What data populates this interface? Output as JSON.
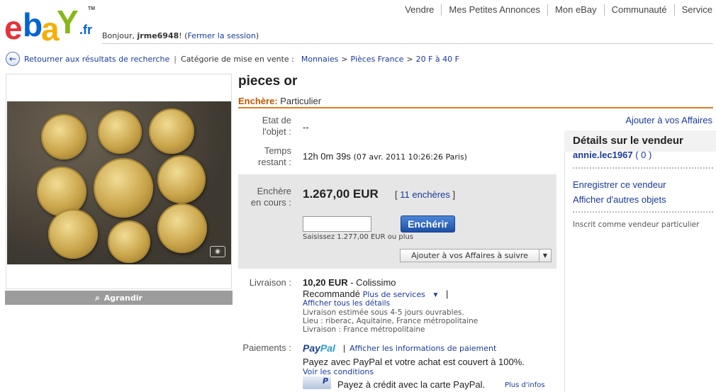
{
  "logo": {
    "e": "e",
    "b": "b",
    "a": "a",
    "y": "Y",
    "tld": ".fr",
    "tm": "TM"
  },
  "header": {
    "greeting_prefix": "Bonjour, ",
    "username": "jrme6948",
    "greeting_suffix": "! (",
    "logout": "Fermer la session",
    "close_paren": ")",
    "nav": [
      "Vendre",
      "Mes Petites Annonces",
      "Mon eBay",
      "Communauté",
      "Service"
    ]
  },
  "breadcrumb": {
    "back": "Retourner aux résultats de recherche",
    "sep": "|",
    "category_label": "Catégorie de mise en vente :",
    "items": [
      "Monnaies",
      "Pièces France",
      "20 F à 40 F"
    ],
    "arrow": ">"
  },
  "image": {
    "enlarge": "Agrandir"
  },
  "item": {
    "title": "pieces or",
    "type_label": "Enchère:",
    "type_value": "Particulier",
    "condition_label_1": "Etat de",
    "condition_label_2": "l'objet :",
    "condition_value": "--",
    "time_label_1": "Temps",
    "time_label_2": "restant :",
    "time_value": "12h 0m 39s",
    "time_date": "(07 avr. 2011 10:26:26 Paris)"
  },
  "bid": {
    "label_1": "Enchère",
    "label_2": "en cours :",
    "price": "1.267,00 EUR",
    "bids_open": "[",
    "bids_link": "11 enchères",
    "bids_close": "]",
    "input_value": "",
    "button": "Enchérir",
    "hint": "Saisissez 1.277,00 EUR ou plus",
    "watch_button": "Ajouter à vos Affaires à suivre"
  },
  "shipping": {
    "label": "Livraison :",
    "price": "10,20 EUR",
    "method_1": " - Colissimo",
    "method_2": "Recommandé",
    "more_services": "Plus de services",
    "pipe": "|",
    "all_details": "Afficher tous les détails",
    "estimate": "Livraison estimée sous 4-5 jours ouvrables.",
    "location": "Lieu : riberac, Aquitaine, France métropolitaine",
    "delivery": "Livraison : France métropolitaine"
  },
  "payment": {
    "label": "Paiements :",
    "logo_1": "Pay",
    "logo_2": "Pal",
    "pipe": "|",
    "info_link": "Afficher les informations de paiement",
    "coverage": "Payez avec PayPal et votre achat est couvert à 100%.",
    "conditions": "Voir les conditions",
    "credit": "Payez à crédit avec la carte PayPal.",
    "more_info": "Plus d'infos"
  },
  "seller": {
    "add_link": "Ajouter à vos Affaires",
    "heading": "Détails sur le vendeur",
    "name": "annie.lec1967",
    "score": "( 0 )",
    "save": "Enregistrer ce vendeur",
    "other_items": "Afficher d'autres objets",
    "registered": "Inscrit comme vendeur particulier"
  },
  "colors": {
    "accent_orange": "#e07a1f",
    "link": "#1a3a9c",
    "button_blue": "#1c4fa4"
  }
}
